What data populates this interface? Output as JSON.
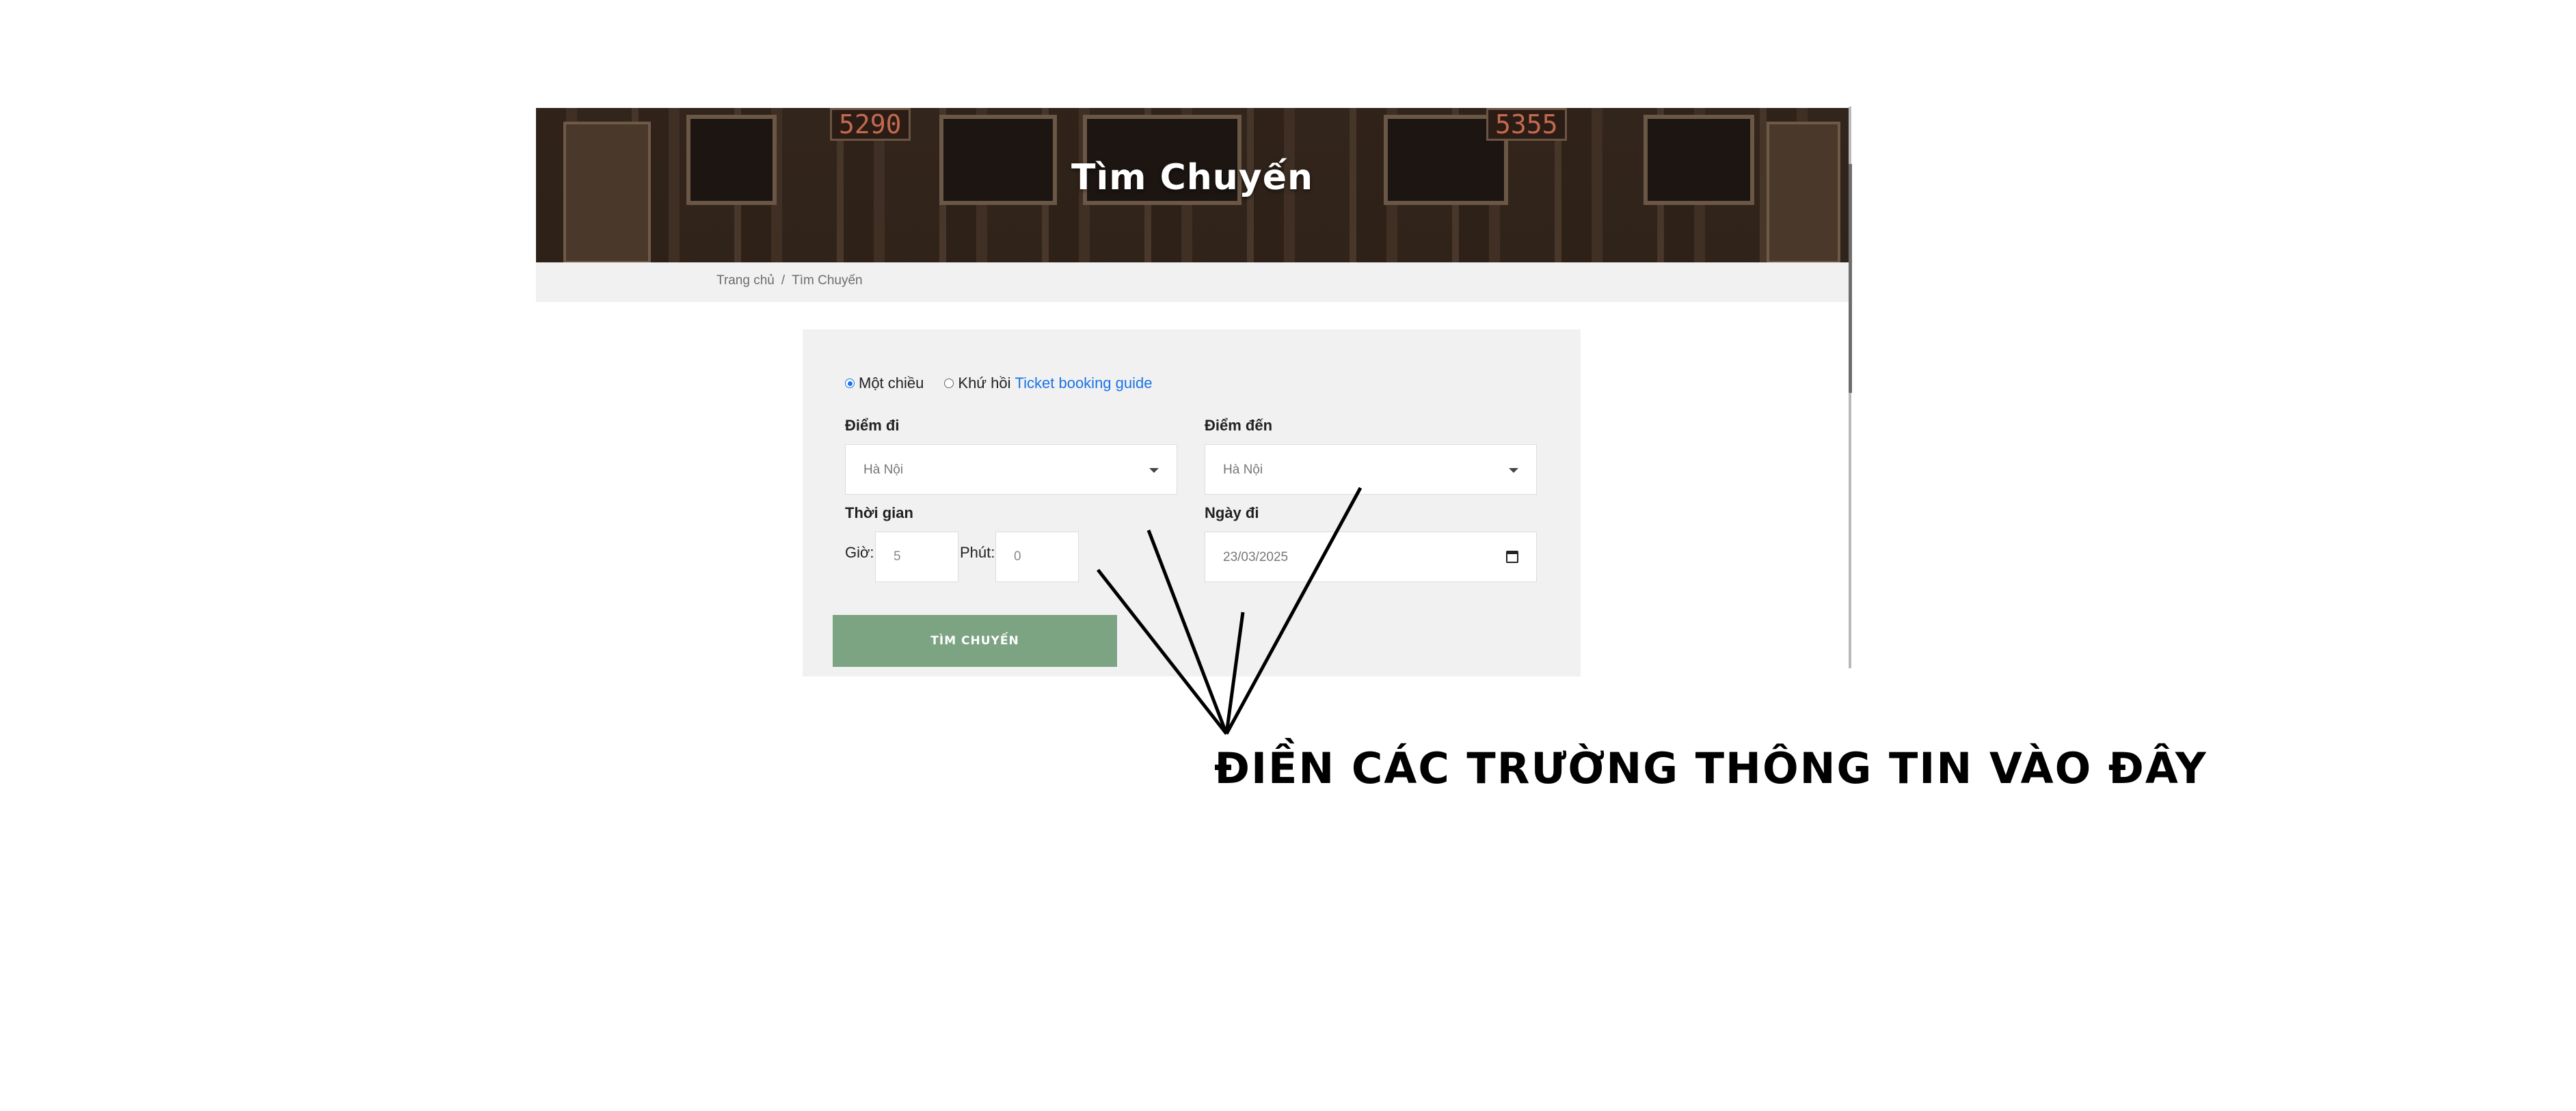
{
  "banner": {
    "title": "Tìm Chuyến",
    "car_numbers": [
      "5290",
      "5355"
    ]
  },
  "breadcrumb": {
    "home": "Trang chủ",
    "separator": "/",
    "current": "Tìm Chuyến"
  },
  "form": {
    "trip_types": [
      {
        "label": "Một chiều",
        "selected": true
      },
      {
        "label": "Khứ hồi",
        "selected": false
      }
    ],
    "guide_link": "Ticket booking guide",
    "from": {
      "label": "Điểm đi",
      "value": "Hà Nội"
    },
    "to": {
      "label": "Điểm đến",
      "value": "Hà Nội"
    },
    "time": {
      "label": "Thời gian",
      "hour_label": "Giờ:",
      "hour_value": "5",
      "minute_label": "Phút:",
      "minute_value": "0"
    },
    "date": {
      "label": "Ngày đi",
      "value": "23/03/2025"
    },
    "search_button": "TÌM CHUYẾN"
  },
  "annotation": {
    "text": "ĐIỀN CÁC TRƯỜNG THÔNG TIN VÀO ĐÂY"
  },
  "colors": {
    "accent_link": "#1a73e8",
    "button": "#7ca382",
    "card_bg": "#f1f1f1"
  }
}
